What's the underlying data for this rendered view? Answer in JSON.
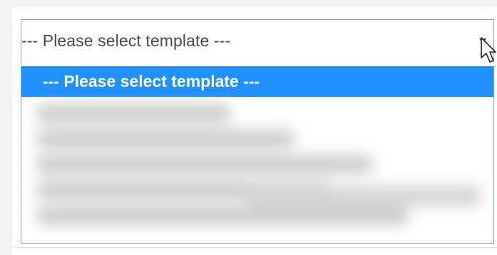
{
  "select": {
    "current_value": "--- Please select template ---"
  },
  "dropdown": {
    "selected_option": "--- Please select template ---",
    "other_options_obscured": true
  },
  "colors": {
    "highlight": "#1e90ff",
    "border": "#7aa7d8",
    "text": "#4a4a4a",
    "background": "#f3f3f3"
  },
  "icons": {
    "dropdown_arrow": "triangle-down",
    "cursor": "arrow-cursor"
  }
}
